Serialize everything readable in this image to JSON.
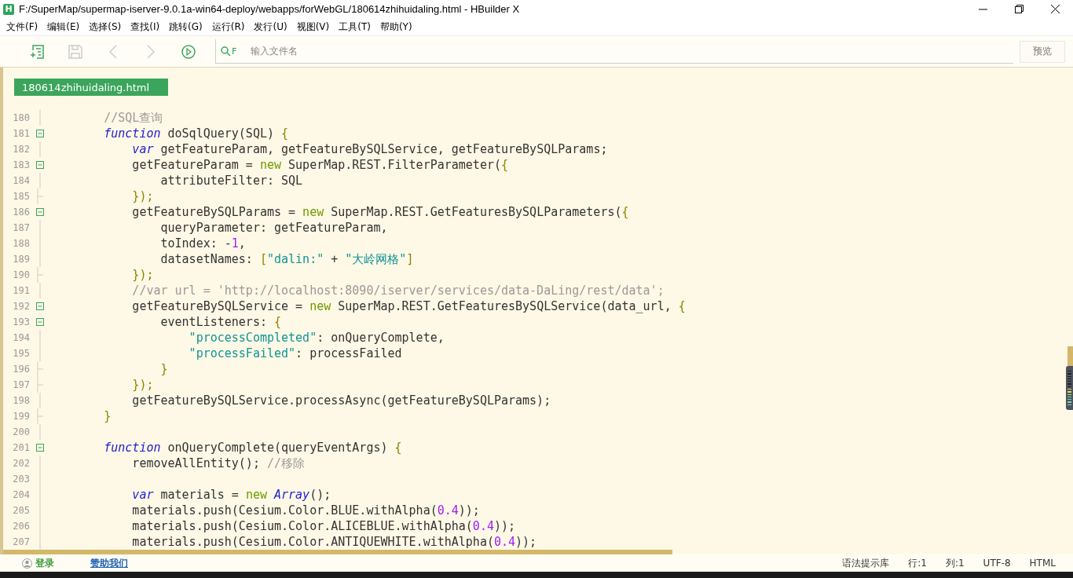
{
  "window": {
    "logo": "H",
    "title": "F:/SuperMap/supermap-iserver-9.0.1a-win64-deploy/webapps/forWebGL/180614zhihuidaling.html - HBuilder X"
  },
  "menu": [
    "文件(F)",
    "编辑(E)",
    "选择(S)",
    "查找(I)",
    "跳转(G)",
    "运行(R)",
    "发行(U)",
    "视图(V)",
    "工具(T)",
    "帮助(Y)"
  ],
  "toolbar": {
    "search_prefix": "F",
    "search": {
      "placeholder": "输入文件名"
    },
    "preview_button": "预览"
  },
  "tabs": [
    {
      "label": "180614zhihuidaling.html",
      "selected": true
    }
  ],
  "lines": [
    {
      "number": "180",
      "foldable": false,
      "block_end": false,
      "tokens": [
        {
          "kind": "cmt",
          "text": "        //SQL查询"
        }
      ]
    },
    {
      "number": "181",
      "foldable": true,
      "block_end": false,
      "tokens": [
        {
          "kind": "kw",
          "text": "        function"
        },
        {
          "kind": "plain",
          "text": " doSqlQuery(SQL) "
        },
        {
          "kind": "punc",
          "text": "{"
        }
      ]
    },
    {
      "number": "182",
      "foldable": false,
      "block_end": false,
      "tokens": [
        {
          "kind": "kw",
          "text": "            var"
        },
        {
          "kind": "plain",
          "text": " getFeatureParam, getFeatureBySQLService, getFeatureBySQLParams;"
        }
      ]
    },
    {
      "number": "183",
      "foldable": true,
      "block_end": false,
      "tokens": [
        {
          "kind": "plain",
          "text": "            getFeatureParam = "
        },
        {
          "kind": "new",
          "text": "new"
        },
        {
          "kind": "plain",
          "text": " SuperMap.REST.FilterParameter("
        },
        {
          "kind": "punc",
          "text": "{"
        }
      ]
    },
    {
      "number": "184",
      "foldable": false,
      "block_end": false,
      "tokens": [
        {
          "kind": "plain",
          "text": "                attributeFilter: SQL"
        }
      ]
    },
    {
      "number": "185",
      "foldable": false,
      "block_end": true,
      "tokens": [
        {
          "kind": "punc",
          "text": "            });"
        }
      ]
    },
    {
      "number": "186",
      "foldable": true,
      "block_end": false,
      "tokens": [
        {
          "kind": "plain",
          "text": "            getFeatureBySQLParams = "
        },
        {
          "kind": "new",
          "text": "new"
        },
        {
          "kind": "plain",
          "text": " SuperMap.REST.GetFeaturesBySQLParameters("
        },
        {
          "kind": "punc",
          "text": "{"
        }
      ]
    },
    {
      "number": "187",
      "foldable": false,
      "block_end": false,
      "tokens": [
        {
          "kind": "plain",
          "text": "                queryParameter: getFeatureParam,"
        }
      ]
    },
    {
      "number": "188",
      "foldable": false,
      "block_end": false,
      "tokens": [
        {
          "kind": "plain",
          "text": "                toIndex: -"
        },
        {
          "kind": "num",
          "text": "1"
        },
        {
          "kind": "plain",
          "text": ","
        }
      ]
    },
    {
      "number": "189",
      "foldable": false,
      "block_end": false,
      "tokens": [
        {
          "kind": "plain",
          "text": "                datasetNames: "
        },
        {
          "kind": "punc",
          "text": "["
        },
        {
          "kind": "str",
          "text": "\"dalin:\""
        },
        {
          "kind": "plain",
          "text": " + "
        },
        {
          "kind": "str",
          "text": "\"大岭网格\""
        },
        {
          "kind": "punc",
          "text": "]"
        }
      ]
    },
    {
      "number": "190",
      "foldable": false,
      "block_end": true,
      "tokens": [
        {
          "kind": "punc",
          "text": "            });"
        }
      ]
    },
    {
      "number": "191",
      "foldable": false,
      "block_end": false,
      "tokens": [
        {
          "kind": "cmt",
          "text": "            //var url = 'http://localhost:8090/iserver/services/data-DaLing/rest/data';"
        }
      ]
    },
    {
      "number": "192",
      "foldable": true,
      "block_end": false,
      "tokens": [
        {
          "kind": "plain",
          "text": "            getFeatureBySQLService = "
        },
        {
          "kind": "new",
          "text": "new"
        },
        {
          "kind": "plain",
          "text": " SuperMap.REST.GetFeaturesBySQLService(data_url, "
        },
        {
          "kind": "punc",
          "text": "{"
        }
      ]
    },
    {
      "number": "193",
      "foldable": true,
      "block_end": false,
      "tokens": [
        {
          "kind": "plain",
          "text": "                eventListeners: "
        },
        {
          "kind": "punc",
          "text": "{"
        }
      ]
    },
    {
      "number": "194",
      "foldable": false,
      "block_end": false,
      "tokens": [
        {
          "kind": "str",
          "text": "                    \"processCompleted\""
        },
        {
          "kind": "plain",
          "text": ": onQueryComplete,"
        }
      ]
    },
    {
      "number": "195",
      "foldable": false,
      "block_end": false,
      "tokens": [
        {
          "kind": "str",
          "text": "                    \"processFailed\""
        },
        {
          "kind": "plain",
          "text": ": processFailed"
        }
      ]
    },
    {
      "number": "196",
      "foldable": false,
      "block_end": true,
      "tokens": [
        {
          "kind": "punc",
          "text": "                }"
        }
      ]
    },
    {
      "number": "197",
      "foldable": false,
      "block_end": true,
      "tokens": [
        {
          "kind": "punc",
          "text": "            });"
        }
      ]
    },
    {
      "number": "198",
      "foldable": false,
      "block_end": false,
      "tokens": [
        {
          "kind": "plain",
          "text": "            getFeatureBySQLService.processAsync(getFeatureBySQLParams);"
        }
      ]
    },
    {
      "number": "199",
      "foldable": false,
      "block_end": true,
      "tokens": [
        {
          "kind": "punc",
          "text": "        }"
        }
      ]
    },
    {
      "number": "200",
      "foldable": false,
      "block_end": false
    },
    {
      "number": "201",
      "foldable": true,
      "block_end": false,
      "tokens": [
        {
          "kind": "kw",
          "text": "        function"
        },
        {
          "kind": "plain",
          "text": " onQueryComplete(queryEventArgs) "
        },
        {
          "kind": "punc",
          "text": "{"
        }
      ]
    },
    {
      "number": "202",
      "foldable": false,
      "block_end": false,
      "tokens": [
        {
          "kind": "plain",
          "text": "            removeAllEntity(); "
        },
        {
          "kind": "cmt",
          "text": "//移除"
        }
      ]
    },
    {
      "number": "203",
      "foldable": false,
      "block_end": false
    },
    {
      "number": "204",
      "foldable": false,
      "block_end": false,
      "tokens": [
        {
          "kind": "kw",
          "text": "            var"
        },
        {
          "kind": "plain",
          "text": " materials = "
        },
        {
          "kind": "new",
          "text": "new"
        },
        {
          "kind": "kw",
          "text": " Array"
        },
        {
          "kind": "plain",
          "text": "();"
        }
      ]
    },
    {
      "number": "205",
      "foldable": false,
      "block_end": false,
      "tokens": [
        {
          "kind": "plain",
          "text": "            materials.push(Cesium.Color.BLUE.withAlpha("
        },
        {
          "kind": "num",
          "text": "0.4"
        },
        {
          "kind": "plain",
          "text": "));"
        }
      ]
    },
    {
      "number": "206",
      "foldable": false,
      "block_end": false,
      "tokens": [
        {
          "kind": "plain",
          "text": "            materials.push(Cesium.Color.ALICEBLUE.withAlpha("
        },
        {
          "kind": "num",
          "text": "0.4"
        },
        {
          "kind": "plain",
          "text": "));"
        }
      ]
    },
    {
      "number": "207",
      "foldable": false,
      "block_end": false,
      "tokens": [
        {
          "kind": "plain",
          "text": "            materials.push(Cesium.Color.ANTIQUEWHITE.withAlpha("
        },
        {
          "kind": "num",
          "text": "0.4"
        },
        {
          "kind": "plain",
          "text": "));"
        }
      ]
    }
  ],
  "status_bar": {
    "login": "登录",
    "sponsor": "赞助我们",
    "items": [
      "语法提示库",
      "行:1",
      "列:1",
      "UTF-8",
      "HTML"
    ]
  }
}
